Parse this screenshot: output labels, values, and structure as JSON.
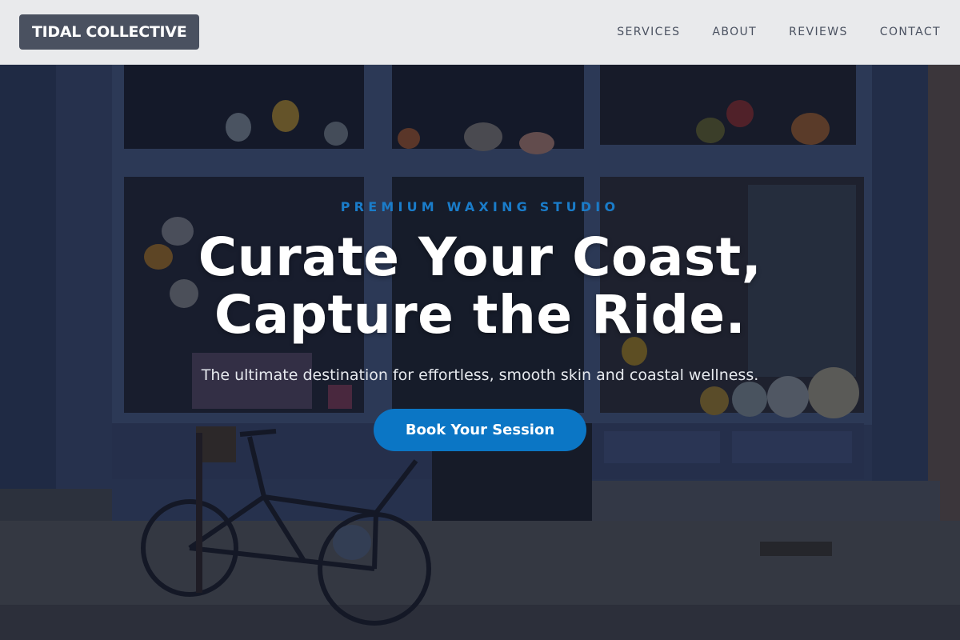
{
  "header": {
    "logo": "TIDAL COLLECTIVE",
    "nav": [
      {
        "label": "SERVICES"
      },
      {
        "label": "ABOUT"
      },
      {
        "label": "REVIEWS"
      },
      {
        "label": "CONTACT"
      }
    ]
  },
  "hero": {
    "eyebrow": "PREMIUM WAXING STUDIO",
    "headline_line1": "Curate Your Coast,",
    "headline_line2": "Capture the Ride.",
    "subline": "The ultimate destination for effortless, smooth skin and coastal wellness.",
    "cta_label": "Book Your Session",
    "background_image": "storefront-with-bicycle"
  },
  "colors": {
    "accent": "#0b76c5",
    "eyebrow": "#1a7cc9",
    "header_bg": "#e9eaec",
    "logo_bg": "#4a5160"
  }
}
